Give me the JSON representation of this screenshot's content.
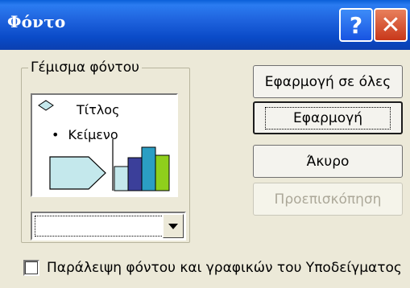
{
  "window": {
    "title": "Φόντο",
    "help_label": "?",
    "close_label": "✕"
  },
  "fill_group": {
    "label": "Γέμισμα φόντου",
    "preview": {
      "title_text": "Τίτλος",
      "bullet": "•",
      "body_text": "Κείμενο",
      "chart_colors": [
        "#c4e8ec",
        "#3b3f9a",
        "#2b9ec3",
        "#8fcf1c"
      ],
      "arrow_color": "#c4e8ec"
    },
    "combo_value": ""
  },
  "buttons": {
    "apply_all": "Εφαρμογή σε όλες",
    "apply": "Εφαρμογή",
    "cancel": "Άκυρο",
    "preview": "Προεπισκόπηση"
  },
  "omit_checkbox": {
    "label": "Παράλειψη φόντου και γραφικών του Υποδείγματος",
    "checked": false
  }
}
